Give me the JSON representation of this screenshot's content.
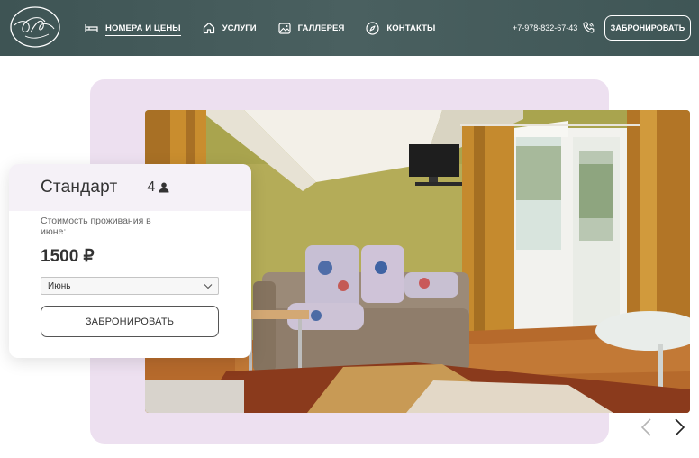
{
  "header": {
    "logo_icon": "monogram-logo-icon",
    "nav": [
      {
        "label": "НОМЕРА И ЦЕНЫ",
        "icon": "bed-icon",
        "active": true
      },
      {
        "label": "УСЛУГИ",
        "icon": "home-icon",
        "active": false
      },
      {
        "label": "ГАЛЛЕРЕЯ",
        "icon": "image-icon",
        "active": false
      },
      {
        "label": "КОНТАКТЫ",
        "icon": "compass-icon",
        "active": false
      }
    ],
    "phone": "+7-978-832-67-43",
    "phone_icon": "phone-icon",
    "book_label": "ЗАБРОНИРОВАТЬ"
  },
  "room_card": {
    "title": "Стандарт",
    "guests": "4",
    "guests_icon": "person-icon",
    "price_label": "Стоимость проживания в июне:",
    "price": "1500 ₽",
    "month_selected": "Июнь",
    "book_label": "ЗАБРОНИРОВАТЬ"
  },
  "gallery": {
    "prev_icon": "chevron-left-icon",
    "next_icon": "chevron-right-icon"
  },
  "colors": {
    "header_bg": "#455b5b",
    "lilac_bg": "#ede0f0",
    "wall": "#a8a04a",
    "curtain": "#c88a2a"
  }
}
